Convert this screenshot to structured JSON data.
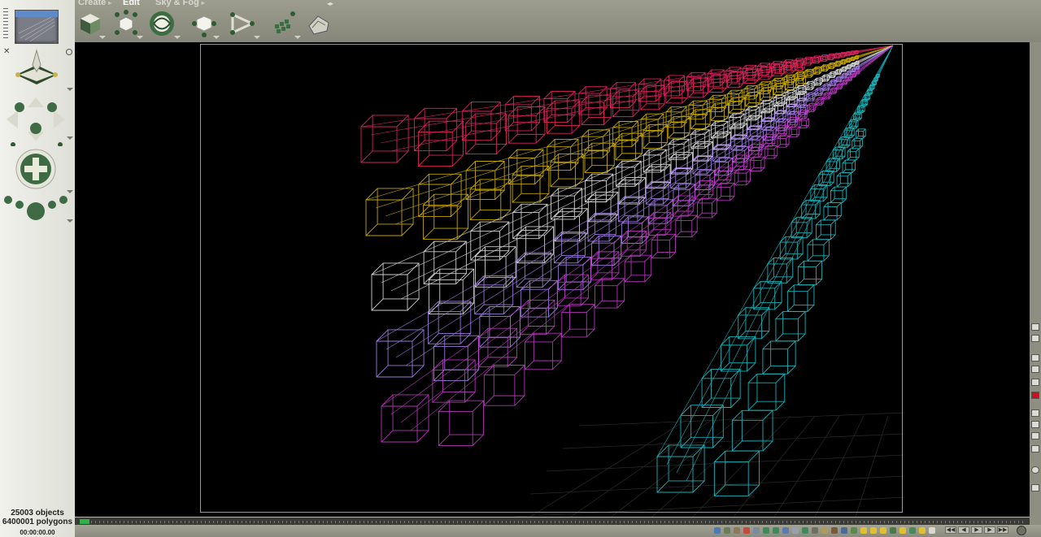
{
  "toolbar": {
    "tabs": [
      {
        "label": "Create",
        "active": false
      },
      {
        "label": "Edit",
        "active": true
      },
      {
        "label": "Sky & Fog",
        "active": false
      }
    ],
    "tools": [
      "cube-object-icon",
      "move-vertices-icon",
      "sphere-object-icon",
      "transform-icon",
      "path-icon",
      "array-icon",
      "terrain-icon"
    ]
  },
  "left_panel": {
    "tools": [
      "camera-preview",
      "object-manipulator-icon",
      "pan-arrows-icon",
      "rotate-sphere-icon"
    ]
  },
  "status": {
    "objects": "25003 objects",
    "polygons": "6400001 polygons",
    "time": "00:00:00.00"
  },
  "scene": {
    "background": "#000000",
    "vanishing_point": "top-right",
    "colors": [
      "#ff2a6e",
      "#e6c200",
      "#f4f4f4",
      "#b58cff",
      "#d23fd8",
      "#1fd0d8"
    ]
  }
}
